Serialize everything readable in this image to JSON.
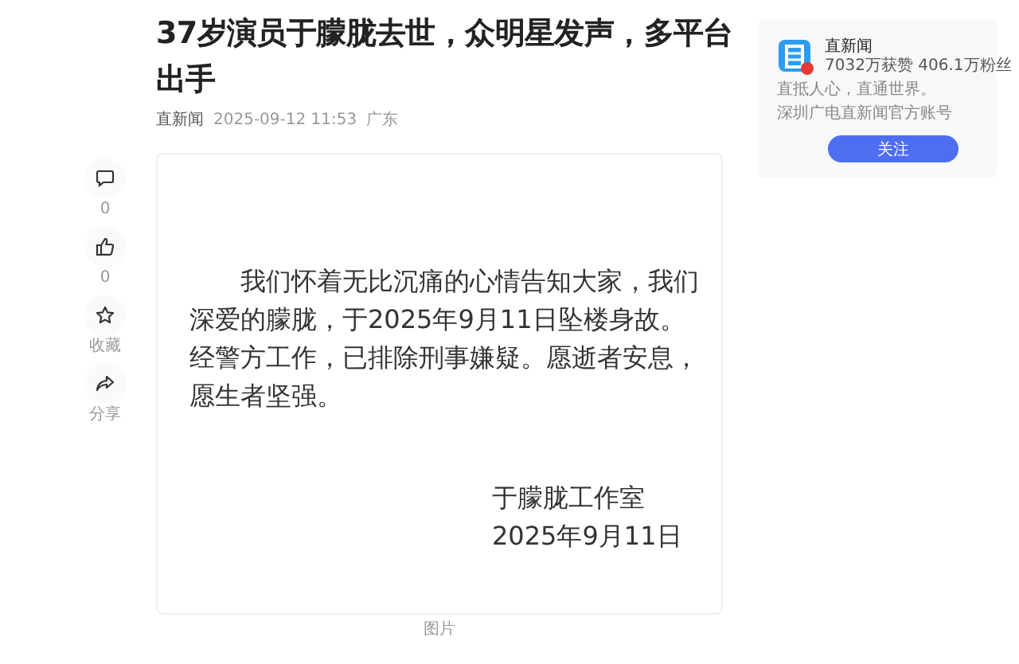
{
  "article": {
    "title": "37岁演员于朦胧去世，众明星发声，多平台出手",
    "source": "直新闻",
    "time": "2025-09-12 11:53",
    "location": "广东"
  },
  "actions": [
    {
      "kind": "comment",
      "label": "0"
    },
    {
      "kind": "like",
      "label": "0"
    },
    {
      "kind": "favorite",
      "label": "收藏"
    },
    {
      "kind": "share",
      "label": "分享"
    }
  ],
  "statement": {
    "body": "我们怀着无比沉痛的心情告知大家，我们深爱的朦胧，于2025年9月11日坠楼身故。经警方工作，已排除刑事嫌疑。愿逝者安息，愿生者坚强。",
    "signature": "于朦胧工作室",
    "date": "2025年9月11日",
    "caption": "图片"
  },
  "author": {
    "name": "直新闻",
    "stats": "7032万获赞 406.1万粉丝",
    "bio_lines": [
      "直抵人心，直通世界。",
      "深圳广电直新闻官方账号"
    ],
    "follow_button": "关注"
  }
}
